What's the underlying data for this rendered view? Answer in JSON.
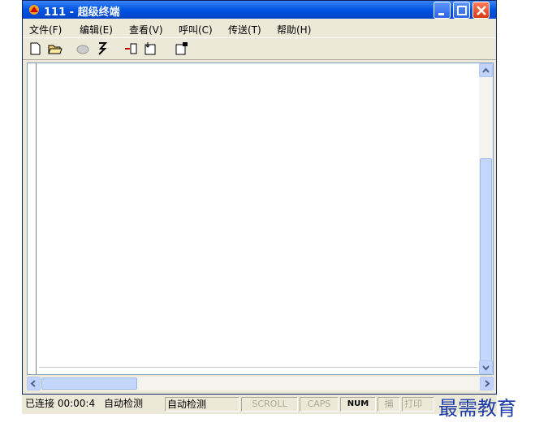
{
  "window": {
    "title": "111 - 超级终端",
    "icons": {
      "app": "hyperterminal-app-icon",
      "minimize": "minimize-icon",
      "maximize": "maximize-icon",
      "close": "close-icon"
    }
  },
  "menu": {
    "items": [
      "文件(F)",
      "编辑(E)",
      "查看(V)",
      "呼叫(C)",
      "传送(T)",
      "帮助(H)"
    ]
  },
  "toolbar": {
    "buttons": [
      "new-icon",
      "open-icon",
      "call-icon",
      "disconnect-icon",
      "send-icon",
      "receive-icon",
      "properties-icon"
    ]
  },
  "status": {
    "connected": "已连接 00:00:4",
    "detect1": "自动检测",
    "detect2": "自动检测",
    "scroll": "SCROLL",
    "caps": "CAPS",
    "num": "NUM",
    "capture": "捕",
    "print": "打印"
  },
  "watermark": {
    "text": "最需教育"
  },
  "colors": {
    "titlebar": "#0054e3",
    "chrome": "#ece9d8",
    "scrollbar": "#c1d3fb"
  }
}
